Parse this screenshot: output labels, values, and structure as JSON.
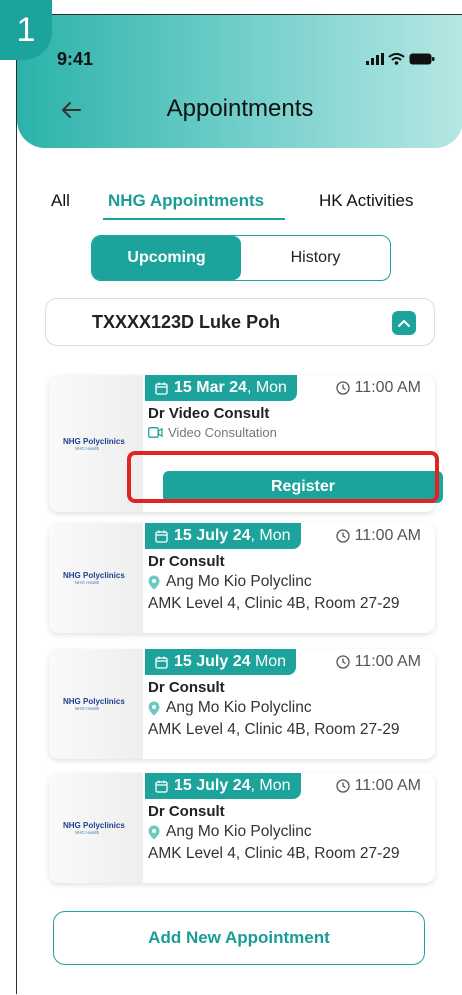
{
  "step_badge": "1",
  "status": {
    "time": "9:41"
  },
  "header": {
    "title": "Appointments"
  },
  "tabs": [
    {
      "label": "All"
    },
    {
      "label": "NHG Appointments"
    },
    {
      "label": "HK Activities"
    }
  ],
  "segment": {
    "upcoming": "Upcoming",
    "history": "History"
  },
  "patient": {
    "name": "TXXXX123D Luke Poh"
  },
  "logo": {
    "line1": "NHG Polyclinics",
    "line2": "NHG Health"
  },
  "appointments": [
    {
      "date_bold": "15 Mar 24",
      "date_rest": ", Mon",
      "time": "11:00 AM",
      "doctor": "Dr Video Consult",
      "type": "Video Consultation",
      "action": "Register"
    },
    {
      "date_bold": "15 July 24",
      "date_rest": ", Mon",
      "time": "11:00 AM",
      "doctor": "Dr Consult",
      "location": "Ang Mo Kio Polyclinc",
      "address": "AMK Level 4, Clinic 4B, Room 27-29"
    },
    {
      "date_bold": "15 July 24",
      "date_rest": " Mon",
      "time": "11:00 AM",
      "doctor": "Dr Consult",
      "location": "Ang Mo Kio Polyclinc",
      "address": "AMK Level 4, Clinic 4B, Room 27-29"
    },
    {
      "date_bold": "15 July 24",
      "date_rest": ", Mon",
      "time": "11:00 AM",
      "doctor": "Dr Consult",
      "location": "Ang Mo Kio Polyclinc",
      "address": "AMK Level 4, Clinic 4B, Room 27-29"
    }
  ],
  "add_button": "Add New Appointment",
  "colors": {
    "accent": "#1ba39c",
    "highlight": "#e02424"
  }
}
